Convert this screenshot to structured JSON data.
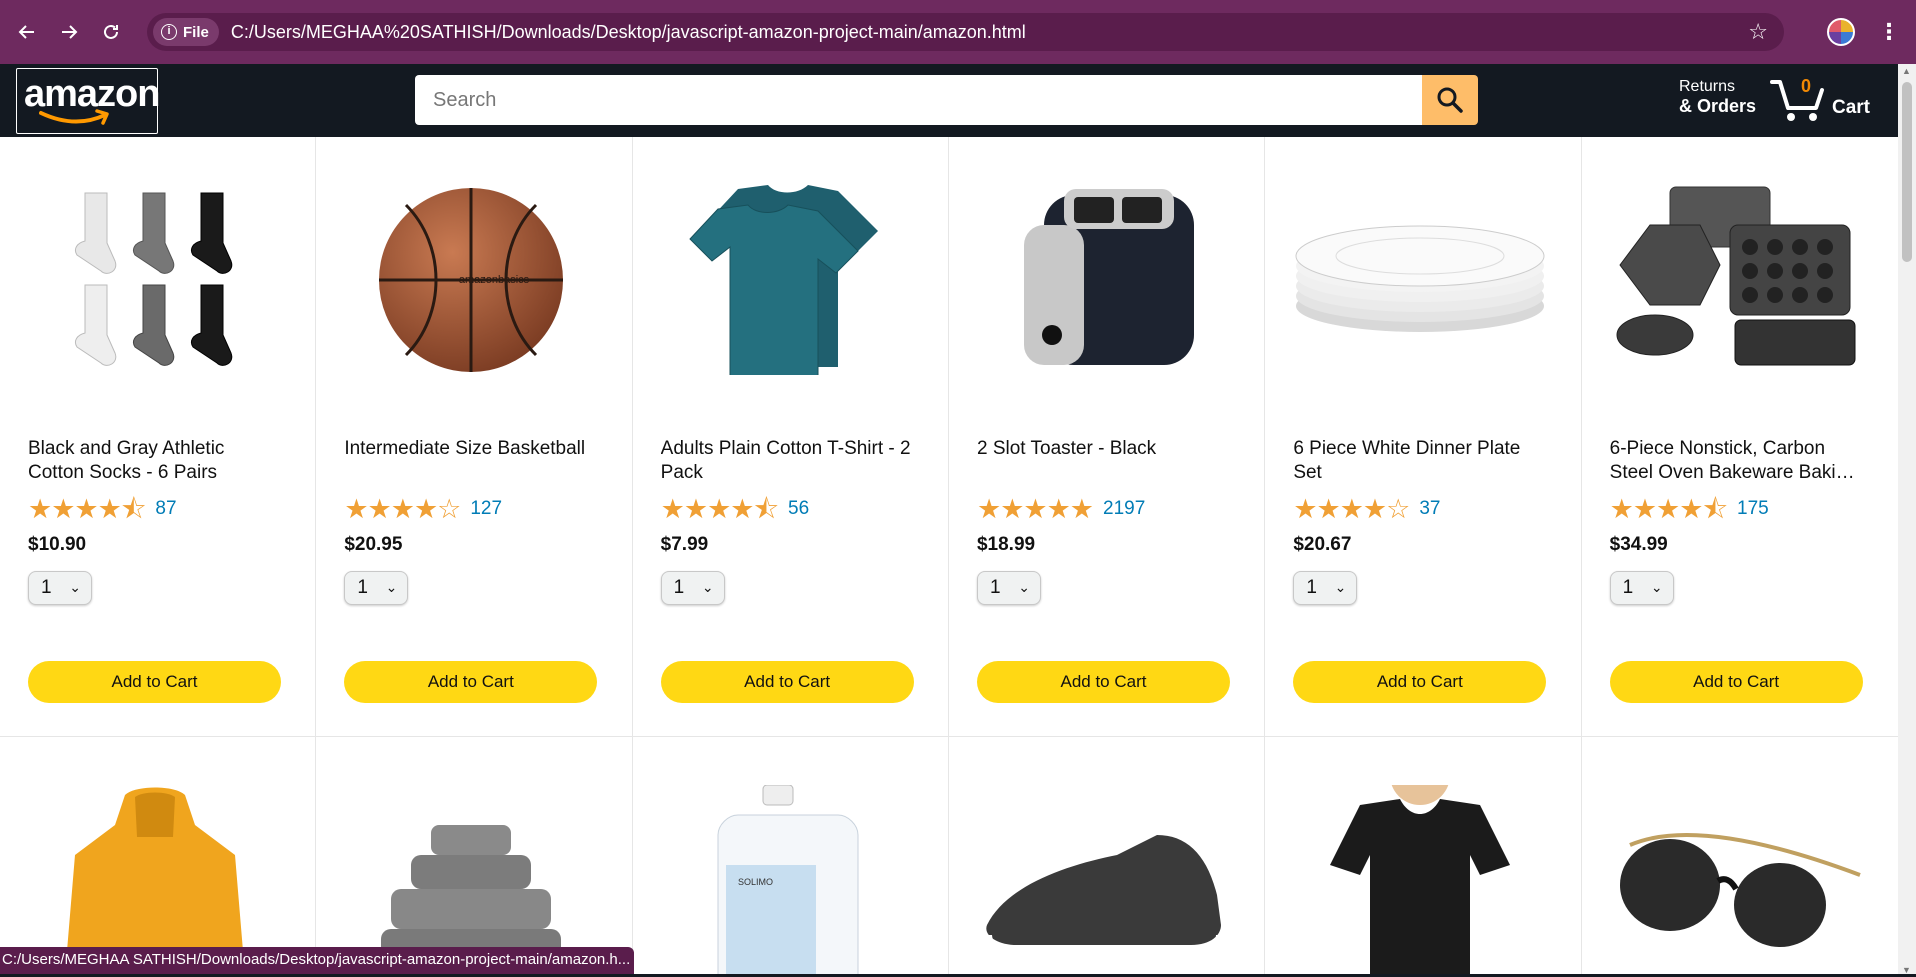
{
  "browser": {
    "file_label": "File",
    "url": "C:/Users/MEGHAA%20SATHISH/Downloads/Desktop/javascript-amazon-project-main/amazon.html",
    "status_text": "C:/Users/MEGHAA SATHISH/Downloads/Desktop/javascript-amazon-project-main/amazon.h...",
    "icons": [
      "back-arrow-icon",
      "forward-arrow-icon",
      "reload-icon",
      "info-icon",
      "bookmark-star-icon",
      "profile-icon",
      "more-menu-icon"
    ]
  },
  "header": {
    "logo_text": "amazon",
    "search_placeholder": "Search",
    "returns_line1": "Returns",
    "returns_line2": "& Orders",
    "cart_quantity": "0",
    "cart_label": "Cart"
  },
  "colors": {
    "browser_frame": "#6e2a5f",
    "header_bg": "#131921",
    "search_button": "#febd69",
    "add_to_cart_button": "#ffd814",
    "star": "#f0a035",
    "rating_count": "#017cb6",
    "cart_quantity": "#f08804"
  },
  "products": [
    {
      "name": "Black and Gray Athletic Cotton Socks - 6 Pairs",
      "stars": "★★★★⯪",
      "rating": 4.5,
      "count": "87",
      "price": "$10.90",
      "qty": "1",
      "button": "Add to Cart",
      "image": "socks"
    },
    {
      "name": "Intermediate Size Basketball",
      "stars": "★★★★☆",
      "rating": 4.0,
      "count": "127",
      "price": "$20.95",
      "qty": "1",
      "button": "Add to Cart",
      "image": "basketball"
    },
    {
      "name": "Adults Plain Cotton T-Shirt - 2 Pack",
      "stars": "★★★★⯪",
      "rating": 4.5,
      "count": "56",
      "price": "$7.99",
      "qty": "1",
      "button": "Add to Cart",
      "image": "tshirt"
    },
    {
      "name": "2 Slot Toaster - Black",
      "stars": "★★★★★",
      "rating": 5.0,
      "count": "2197",
      "price": "$18.99",
      "qty": "1",
      "button": "Add to Cart",
      "image": "toaster"
    },
    {
      "name": "6 Piece White Dinner Plate Set",
      "stars": "★★★★☆",
      "rating": 4.0,
      "count": "37",
      "price": "$20.67",
      "qty": "1",
      "button": "Add to Cart",
      "image": "plates"
    },
    {
      "name": "6-Piece Nonstick, Carbon Steel Oven Bakeware Baki…",
      "stars": "★★★★⯪",
      "rating": 4.5,
      "count": "175",
      "price": "$34.99",
      "qty": "1",
      "button": "Add to Cart",
      "image": "bakeware"
    }
  ],
  "products_row2": [
    {
      "image": "hoodie"
    },
    {
      "image": "towels"
    },
    {
      "image": "detergent"
    },
    {
      "image": "sneaker"
    },
    {
      "image": "black-top"
    },
    {
      "image": "sunglasses"
    }
  ]
}
